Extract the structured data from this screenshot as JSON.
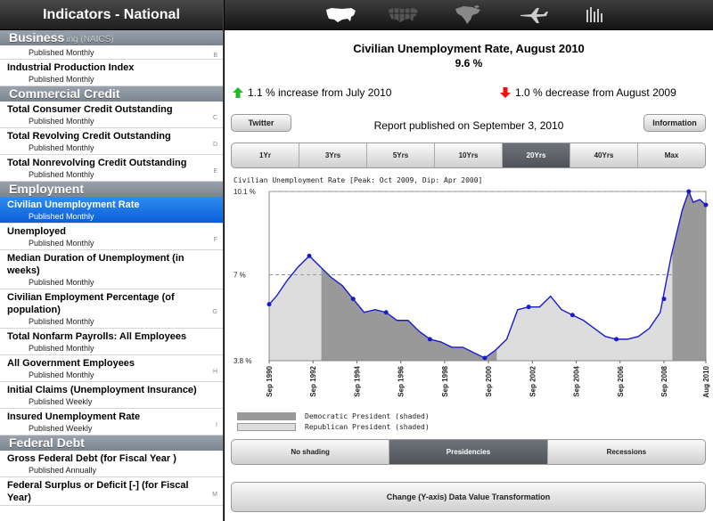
{
  "left": {
    "title": "Indicators - National",
    "sections": [
      {
        "header": "Business",
        "ghost": "ing (NAICS)",
        "items": [
          {
            "name": "",
            "freq": "Published Monthly",
            "idx": "B"
          },
          {
            "name": "Industrial Production Index",
            "freq": "Published Monthly",
            "idx": ""
          }
        ]
      },
      {
        "header": "Commercial Credit",
        "items": [
          {
            "name": "Total Consumer Credit Outstanding",
            "freq": "Published Monthly",
            "idx": "C"
          },
          {
            "name": "Total Revolving Credit Outstanding",
            "freq": "Published Monthly",
            "idx": "D"
          },
          {
            "name": "Total Nonrevolving Credit Outstanding",
            "freq": "Published Monthly",
            "idx": "E"
          }
        ]
      },
      {
        "header": "Employment",
        "items": [
          {
            "name": "Civilian Unemployment Rate",
            "freq": "Published Monthly",
            "idx": "",
            "selected": true
          },
          {
            "name": "Unemployed",
            "freq": "Published Monthly",
            "idx": "F"
          },
          {
            "name": "Median Duration of Unemployment (in weeks)",
            "freq": "Published Monthly",
            "idx": ""
          },
          {
            "name": "Civilian Employment Percentage (of population)",
            "freq": "Published Monthly",
            "idx": "G"
          },
          {
            "name": "Total Nonfarm Payrolls: All Employees",
            "freq": "Published Monthly",
            "idx": ""
          },
          {
            "name": "All Government Employees",
            "freq": "Published Monthly",
            "idx": "H"
          },
          {
            "name": "Initial Claims (Unemployment Insurance)",
            "freq": "Published Weekly",
            "idx": ""
          },
          {
            "name": "Insured Unemployment Rate",
            "freq": "Published Weekly",
            "idx": "I"
          }
        ]
      },
      {
        "header": "Federal Debt",
        "items": [
          {
            "name": "Gross Federal Debt (for Fiscal Year )",
            "freq": "Published Annually",
            "idx": ""
          },
          {
            "name": "Federal Surplus or Deficit [-] (for Fiscal Year)",
            "freq": "",
            "idx": "M"
          }
        ]
      }
    ]
  },
  "toolbar": {
    "icons": [
      "usa-map-icon",
      "states-map-icon",
      "north-america-map-icon",
      "airplane-icon",
      "bar-chart-icon"
    ]
  },
  "main": {
    "title": "Civilian Unemployment Rate, August 2010",
    "value": "9.6 %",
    "increase": "1.1 % increase from July 2010",
    "decrease": "1.0 % decrease from August 2009",
    "twitter": "Twitter",
    "report": "Report published on September 3, 2010",
    "information": "Information",
    "ranges": [
      "1Yr",
      "3Yrs",
      "5Yrs",
      "10Yrs",
      "20Yrs",
      "40Yrs",
      "Max"
    ],
    "range_selected": 4,
    "caption": "Civilian Unemployment Rate [Peak: Oct 2009, Dip: Apr 2000]",
    "legend": [
      "Democratic President (shaded)",
      "Republican President (shaded)"
    ],
    "shading": [
      "No shading",
      "Presidencies",
      "Recessions"
    ],
    "shading_selected": 1,
    "transform": "Change (Y-axis) Data Value Transformation",
    "colors": {
      "up": "#22bb22",
      "down": "#ee1111",
      "line": "#1a1acc",
      "dem": "#999999",
      "rep": "#dddddd",
      "selected": "#0a5fd8"
    }
  },
  "chart_data": {
    "type": "line",
    "title": "Civilian Unemployment Rate [Peak: Oct 2009, Dip: Apr 2000]",
    "ylabel": "",
    "xlabel": "",
    "ylim": [
      3.8,
      10.1
    ],
    "yticks": [
      "10.1 %",
      "7 %",
      "3.8 %"
    ],
    "ytick_values": [
      10.1,
      7,
      3.8
    ],
    "xticks": [
      "Sep 1990",
      "Sep 1992",
      "Sep 1994",
      "Sep 1996",
      "Sep 1998",
      "Sep 2000",
      "Sep 2002",
      "Sep 2004",
      "Sep 2006",
      "Sep 2008",
      "Aug 2010"
    ],
    "xtick_years": [
      1990.67,
      1992.67,
      1994.67,
      1996.67,
      1998.67,
      2000.67,
      2002.67,
      2004.67,
      2006.67,
      2008.67,
      2010.58
    ],
    "xlim": [
      1990.67,
      2010.58
    ],
    "shading_periods": [
      {
        "party": "Republican",
        "from": 1990.67,
        "to": 1993.05
      },
      {
        "party": "Democratic",
        "from": 1993.05,
        "to": 2001.05
      },
      {
        "party": "Republican",
        "from": 2001.05,
        "to": 2009.05
      },
      {
        "party": "Democratic",
        "from": 2009.05,
        "to": 2010.58
      }
    ],
    "series": [
      {
        "values": [
          [
            1990.67,
            5.9
          ],
          [
            1991.0,
            6.2
          ],
          [
            1991.5,
            6.8
          ],
          [
            1992.0,
            7.3
          ],
          [
            1992.5,
            7.7
          ],
          [
            1993.0,
            7.3
          ],
          [
            1993.5,
            6.9
          ],
          [
            1994.0,
            6.6
          ],
          [
            1994.5,
            6.1
          ],
          [
            1995.0,
            5.6
          ],
          [
            1995.5,
            5.7
          ],
          [
            1996.0,
            5.6
          ],
          [
            1996.5,
            5.3
          ],
          [
            1997.0,
            5.3
          ],
          [
            1997.5,
            4.9
          ],
          [
            1998.0,
            4.6
          ],
          [
            1998.5,
            4.5
          ],
          [
            1999.0,
            4.3
          ],
          [
            1999.5,
            4.3
          ],
          [
            2000.0,
            4.1
          ],
          [
            2000.5,
            3.9
          ],
          [
            2001.0,
            4.2
          ],
          [
            2001.5,
            4.6
          ],
          [
            2002.0,
            5.7
          ],
          [
            2002.5,
            5.8
          ],
          [
            2003.0,
            5.8
          ],
          [
            2003.5,
            6.2
          ],
          [
            2004.0,
            5.7
          ],
          [
            2004.5,
            5.5
          ],
          [
            2005.0,
            5.3
          ],
          [
            2005.5,
            5.0
          ],
          [
            2006.0,
            4.7
          ],
          [
            2006.5,
            4.6
          ],
          [
            2007.0,
            4.6
          ],
          [
            2007.5,
            4.7
          ],
          [
            2008.0,
            5.0
          ],
          [
            2008.5,
            5.6
          ],
          [
            2009.0,
            7.7
          ],
          [
            2009.5,
            9.4
          ],
          [
            2009.8,
            10.1
          ],
          [
            2010.0,
            9.7
          ],
          [
            2010.3,
            9.8
          ],
          [
            2010.58,
            9.6
          ]
        ],
        "markers": [
          [
            1990.67,
            5.9
          ],
          [
            1992.5,
            7.7
          ],
          [
            1994.5,
            6.1
          ],
          [
            1996.0,
            5.6
          ],
          [
            1998.0,
            4.6
          ],
          [
            2000.5,
            3.9
          ],
          [
            2002.5,
            5.8
          ],
          [
            2004.5,
            5.5
          ],
          [
            2006.5,
            4.6
          ],
          [
            2008.67,
            6.1
          ],
          [
            2009.8,
            10.1
          ],
          [
            2010.58,
            9.6
          ]
        ]
      }
    ]
  }
}
